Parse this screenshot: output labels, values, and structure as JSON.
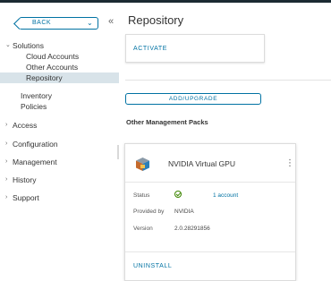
{
  "sidebar": {
    "back_label": "BACK",
    "sections": [
      {
        "label": "Solutions",
        "expanded": true,
        "children": [
          "Cloud Accounts",
          "Other Accounts",
          "Repository"
        ],
        "active_child": "Repository"
      },
      {
        "label": "Inventory"
      },
      {
        "label": "Policies"
      },
      {
        "label": "Access"
      },
      {
        "label": "Configuration"
      },
      {
        "label": "Management"
      },
      {
        "label": "History"
      },
      {
        "label": "Support"
      }
    ]
  },
  "main": {
    "title": "Repository",
    "activate_label": "ACTIVATE",
    "add_upgrade_label": "ADD/UPGRADE",
    "section_title": "Other Management Packs",
    "pack": {
      "name": "NVIDIA Virtual GPU",
      "status_label": "Status",
      "status_value": "1 account",
      "provided_by_label": "Provided by",
      "provided_by_value": "NVIDIA",
      "version_label": "Version",
      "version_value": "2.0.28291856",
      "uninstall_label": "UNINSTALL"
    }
  },
  "colors": {
    "accent": "#0072a3",
    "active_bg": "#d8e3e9",
    "topbar": "#1b2a32",
    "status_ok": "#3c8500"
  }
}
